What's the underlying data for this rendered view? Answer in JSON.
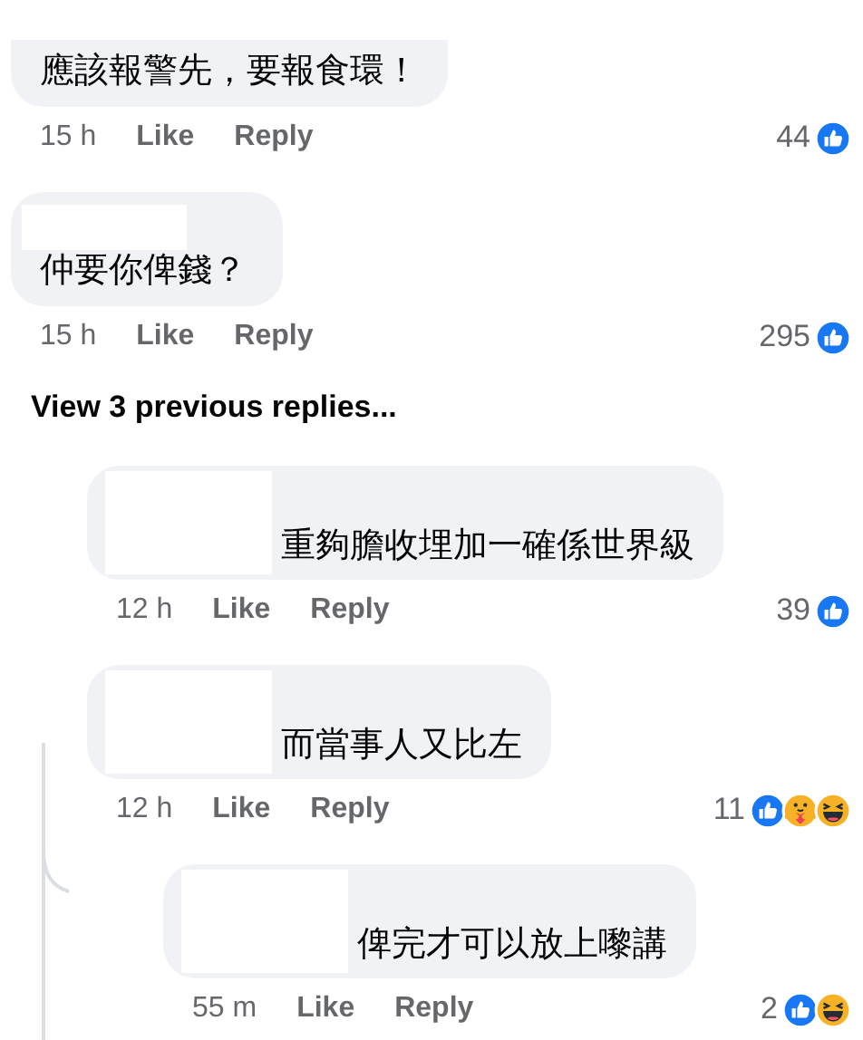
{
  "comments": [
    {
      "text": "應該報警先，要報食環！",
      "time": "15 h",
      "like": "Like",
      "reply": "Reply",
      "count": "44",
      "reactions": [
        {
          "kind": "like"
        }
      ],
      "name_hidden": false
    },
    {
      "text": "仲要你俾錢？",
      "time": "15 h",
      "like": "Like",
      "reply": "Reply",
      "count": "295",
      "reactions": [
        {
          "kind": "like"
        }
      ],
      "name_hidden": true,
      "view_previous": "View 3 previous replies...",
      "replies": [
        {
          "text": "重夠膽收埋加一確係世界級",
          "time": "12 h",
          "like": "Like",
          "reply": "Reply",
          "count": "39",
          "reactions": [
            {
              "kind": "like"
            }
          ],
          "name_hidden": true
        },
        {
          "text": "而當事人又比左",
          "time": "12 h",
          "like": "Like",
          "reply": "Reply",
          "count": "11",
          "reactions": [
            {
              "kind": "like"
            },
            {
              "kind": "care"
            },
            {
              "kind": "haha"
            }
          ],
          "name_hidden": true,
          "replies": [
            {
              "text": "俾完才可以放上嚟講",
              "time": "55 m",
              "like": "Like",
              "reply": "Reply",
              "count": "2",
              "reactions": [
                {
                  "kind": "like"
                },
                {
                  "kind": "haha"
                }
              ],
              "name_hidden": true
            }
          ]
        }
      ]
    }
  ]
}
